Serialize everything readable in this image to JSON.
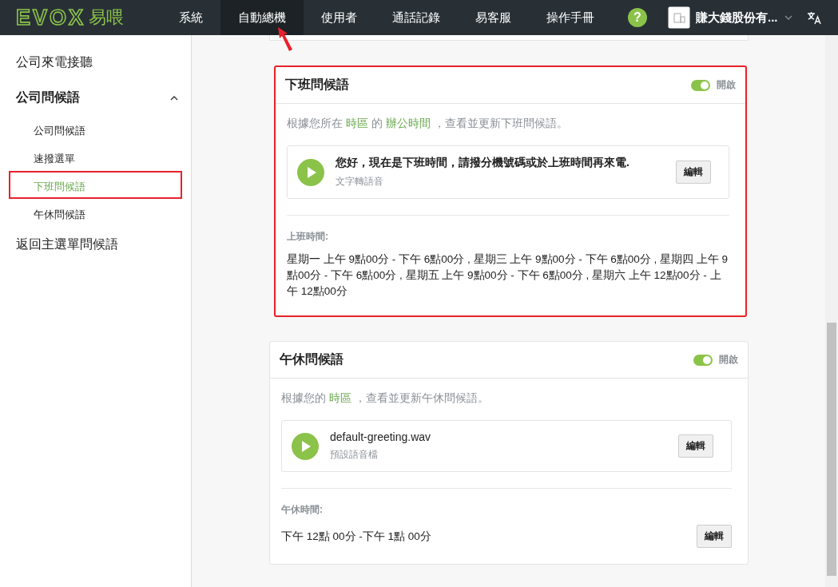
{
  "nav": {
    "logo": "EVOX",
    "logo_suffix": "易喂",
    "items": [
      {
        "label": "系統",
        "selected": false,
        "pointed": false
      },
      {
        "label": "自動總機",
        "selected": true,
        "pointed": true
      },
      {
        "label": "使用者",
        "selected": false,
        "pointed": false
      },
      {
        "label": "通話記錄",
        "selected": false,
        "pointed": false
      },
      {
        "label": "易客服",
        "selected": false,
        "pointed": false
      },
      {
        "label": "操作手冊",
        "selected": false,
        "pointed": false
      }
    ],
    "help": "?",
    "company": "賺大錢股份有..."
  },
  "sidebar": {
    "items": [
      {
        "label": "公司來電接聽",
        "selected": false,
        "expanded": false
      },
      {
        "label": "公司問候語",
        "selected": false,
        "expanded": true,
        "children": [
          {
            "label": "公司問候語",
            "selected": false,
            "highlighted": false
          },
          {
            "label": "速撥選單",
            "selected": false,
            "highlighted": false
          },
          {
            "label": "下班問候語",
            "selected": true,
            "highlighted": true
          },
          {
            "label": "午休問候語",
            "selected": false,
            "highlighted": false
          }
        ]
      },
      {
        "label": "返回主選單問候語",
        "selected": false,
        "expanded": false
      }
    ]
  },
  "cards": [
    {
      "title": "下班問候語",
      "highlighted": true,
      "toggle": {
        "on": true,
        "label": "開啟"
      },
      "description": [
        {
          "text": "根據您所在 ",
          "link": false
        },
        {
          "text": "時區",
          "link": true
        },
        {
          "text": " 的 ",
          "link": false
        },
        {
          "text": "辦公時間",
          "link": true
        },
        {
          "text": " ，查看並更新下班問候語。",
          "link": false
        }
      ],
      "greeting": {
        "title": "您好，現在是下班時間，請撥分機號碼或於上班時間再來電.",
        "subtitle": "文字轉語音",
        "button": "編輯"
      },
      "hours_label": "上班時間:",
      "hours": "星期一 上午 9點00分 - 下午 6點00分 , 星期三 上午 9點00分 - 下午 6點00分 , 星期四 上午 9點00分 - 下午 6點00分 , 星期五 上午 9點00分 - 下午 6點00分 , 星期六 上午 12點00分 - 上午 12點00分"
    },
    {
      "title": "午休問候語",
      "highlighted": false,
      "toggle": {
        "on": true,
        "label": "開啟"
      },
      "description": [
        {
          "text": "根據您的 ",
          "link": false
        },
        {
          "text": "時區",
          "link": true
        },
        {
          "text": " ，查看並更新午休問候語。",
          "link": false
        }
      ],
      "greeting": {
        "title": "default-greeting.wav",
        "subtitle": "預設語音檔",
        "button": "編輯"
      },
      "hours_label": "午休時間:",
      "hours": "下午 12點 00分 -下午 1點 00分",
      "hours_button": "編輯"
    }
  ]
}
